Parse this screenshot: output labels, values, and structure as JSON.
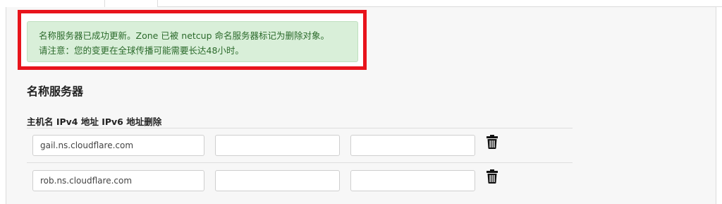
{
  "alert": {
    "line1": "名称服务器已成功更新。Zone 已被 netcup 命名服务器标记为删除对象。",
    "line2": "请注意：您的变更在全球传播可能需要长达48小时。"
  },
  "section": {
    "title": "名称服务器",
    "column_header": "主机名 IPv4 地址 IPv6 地址删除"
  },
  "rows": [
    {
      "hostname": "gail.ns.cloudflare.com",
      "ipv4": "",
      "ipv6": "",
      "delete_icon": "trash-icon"
    },
    {
      "hostname": "rob.ns.cloudflare.com",
      "ipv4": "",
      "ipv6": "",
      "delete_icon": "trash-icon"
    }
  ],
  "colors": {
    "highlight_border": "#e8141c",
    "alert_background": "#d9efd9",
    "alert_text": "#2b6a2b"
  }
}
